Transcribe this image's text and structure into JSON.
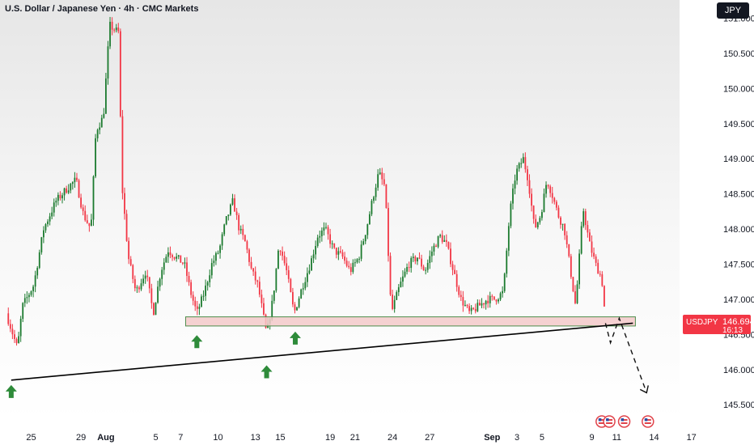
{
  "header": {
    "title": "U.S. Dollar / Japanese Yen · 4h · CMC Markets",
    "currency": "JPY"
  },
  "price_label": {
    "symbol": "USDJPY",
    "price": "146.694",
    "timer": "16:13",
    "value": 146.694
  },
  "colors": {
    "up": "#1b7a2e",
    "down": "#f23645",
    "zone_fill": "#f3c9c9",
    "zone_border": "#4c8c4a",
    "trendline": "#000000",
    "arrow": "#2e8b3a",
    "event_icon": "#e0434b"
  },
  "icons": [
    "arrow-up-icon",
    "dashed-projection-arrow-icon",
    "flag-icon"
  ],
  "chart_data": {
    "type": "candlestick",
    "title": "U.S. Dollar / Japanese Yen · 4h · CMC Markets",
    "symbol": "USDJPY",
    "ylim": [
      145.3,
      151.2
    ],
    "y_ticks": [
      {
        "label": "151.000",
        "value": 151.0
      },
      {
        "label": "150.500",
        "value": 150.5
      },
      {
        "label": "150.000",
        "value": 150.0
      },
      {
        "label": "149.500",
        "value": 149.5
      },
      {
        "label": "149.000",
        "value": 149.0
      },
      {
        "label": "148.500",
        "value": 148.5
      },
      {
        "label": "148.000",
        "value": 148.0
      },
      {
        "label": "147.500",
        "value": 147.5
      },
      {
        "label": "147.000",
        "value": 147.0
      },
      {
        "label": "146.500",
        "value": 146.5
      },
      {
        "label": "146.000",
        "value": 146.0
      },
      {
        "label": "145.500",
        "value": 145.5
      }
    ],
    "x_ticks": [
      {
        "label": "25",
        "t": 2
      },
      {
        "label": "29",
        "t": 6
      },
      {
        "label": "Aug",
        "t": 8,
        "month": true
      },
      {
        "label": "5",
        "t": 12
      },
      {
        "label": "7",
        "t": 14
      },
      {
        "label": "10",
        "t": 17
      },
      {
        "label": "13",
        "t": 20
      },
      {
        "label": "15",
        "t": 22
      },
      {
        "label": "19",
        "t": 26
      },
      {
        "label": "21",
        "t": 28
      },
      {
        "label": "24",
        "t": 31
      },
      {
        "label": "27",
        "t": 34
      },
      {
        "label": "Sep",
        "t": 39,
        "month": true
      },
      {
        "label": "3",
        "t": 41
      },
      {
        "label": "5",
        "t": 43
      },
      {
        "label": "9",
        "t": 47
      },
      {
        "label": "11",
        "t": 49
      },
      {
        "label": "14",
        "t": 52
      },
      {
        "label": "17",
        "t": 55
      }
    ],
    "last_price": 146.694,
    "support_zone": {
      "from_t": 14.4,
      "to_t": 50.5,
      "low": 146.62,
      "high": 146.75
    },
    "trendline": {
      "t1": 0.4,
      "y1": 145.85,
      "t2": 50.3,
      "y2": 146.66
    },
    "projection": [
      [
        48.1,
        146.66
      ],
      [
        48.5,
        146.38
      ],
      [
        49.2,
        146.73
      ],
      [
        51.4,
        145.67
      ]
    ],
    "arrows": [
      {
        "t": 0.4,
        "y": 145.78
      },
      {
        "t": 15.3,
        "y": 146.49
      },
      {
        "t": 20.9,
        "y": 146.06
      },
      {
        "t": 23.2,
        "y": 146.54
      }
    ],
    "event_markers_t": [
      47.8,
      48.4,
      49.6,
      51.5
    ],
    "anchors": [
      [
        0,
        146.8
      ],
      [
        0.9,
        146.3
      ],
      [
        1.3,
        146.9
      ],
      [
        2.2,
        147.2
      ],
      [
        3.0,
        148.0
      ],
      [
        4.0,
        148.4
      ],
      [
        5.0,
        148.6
      ],
      [
        5.6,
        148.7
      ],
      [
        6.2,
        148.2
      ],
      [
        6.8,
        148.0
      ],
      [
        7.2,
        149.4
      ],
      [
        7.8,
        149.6
      ],
      [
        8.3,
        150.9
      ],
      [
        8.6,
        150.85
      ],
      [
        9.0,
        150.8
      ],
      [
        9.3,
        148.6
      ],
      [
        9.8,
        147.6
      ],
      [
        10.4,
        147.1
      ],
      [
        11.2,
        147.4
      ],
      [
        11.8,
        146.8
      ],
      [
        12.4,
        147.4
      ],
      [
        13.0,
        147.7
      ],
      [
        13.6,
        147.6
      ],
      [
        14.3,
        147.5
      ],
      [
        14.8,
        147.1
      ],
      [
        15.3,
        146.8
      ],
      [
        15.9,
        147.1
      ],
      [
        16.5,
        147.5
      ],
      [
        17.1,
        147.7
      ],
      [
        17.6,
        148.1
      ],
      [
        18.2,
        148.4
      ],
      [
        18.7,
        148.0
      ],
      [
        19.2,
        147.8
      ],
      [
        19.7,
        147.4
      ],
      [
        20.2,
        147.2
      ],
      [
        20.9,
        146.5
      ],
      [
        21.4,
        147.0
      ],
      [
        21.9,
        147.8
      ],
      [
        22.5,
        147.4
      ],
      [
        23.1,
        146.8
      ],
      [
        23.8,
        147.2
      ],
      [
        24.4,
        147.5
      ],
      [
        25.0,
        147.9
      ],
      [
        25.6,
        148.0
      ],
      [
        26.3,
        147.7
      ],
      [
        27.0,
        147.6
      ],
      [
        27.6,
        147.4
      ],
      [
        28.3,
        147.6
      ],
      [
        28.9,
        148.0
      ],
      [
        29.5,
        148.5
      ],
      [
        29.9,
        148.8
      ],
      [
        30.4,
        148.6
      ],
      [
        30.9,
        146.8
      ],
      [
        31.6,
        147.2
      ],
      [
        32.3,
        147.5
      ],
      [
        33.0,
        147.6
      ],
      [
        33.6,
        147.4
      ],
      [
        34.2,
        147.7
      ],
      [
        34.8,
        147.9
      ],
      [
        35.3,
        147.8
      ],
      [
        35.9,
        147.4
      ],
      [
        36.5,
        147.0
      ],
      [
        37.2,
        146.8
      ],
      [
        37.9,
        146.9
      ],
      [
        38.6,
        147.0
      ],
      [
        39.2,
        147.0
      ],
      [
        39.9,
        147.1
      ],
      [
        40.4,
        148.2
      ],
      [
        40.9,
        148.8
      ],
      [
        41.5,
        149.0
      ],
      [
        41.9,
        148.7
      ],
      [
        42.4,
        148.0
      ],
      [
        42.9,
        148.2
      ],
      [
        43.4,
        148.7
      ],
      [
        43.8,
        148.5
      ],
      [
        44.3,
        148.2
      ],
      [
        44.8,
        148.0
      ],
      [
        45.3,
        147.4
      ],
      [
        45.7,
        146.9
      ],
      [
        46.3,
        148.3
      ],
      [
        46.8,
        147.8
      ],
      [
        47.3,
        147.5
      ],
      [
        47.8,
        147.3
      ],
      [
        48.1,
        146.69
      ]
    ],
    "anchors_t_unit": "days since Jul 23 (x-tick positions above)",
    "note": ""
  }
}
